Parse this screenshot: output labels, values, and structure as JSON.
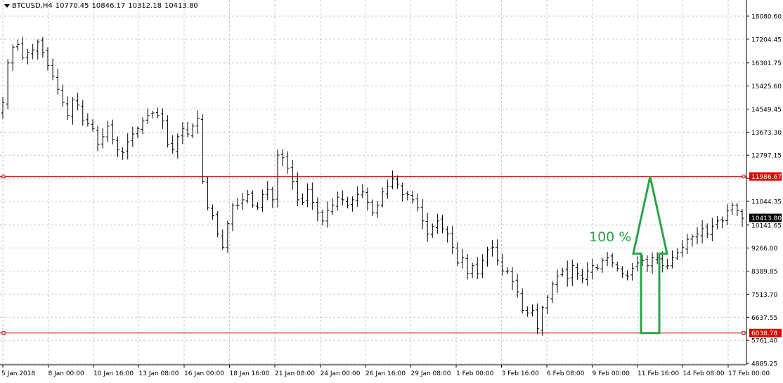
{
  "header": {
    "symbol": "BTCUSD,H4",
    "open": "10770.45",
    "high": "10846.17",
    "low": "10312.18",
    "close": "10413.80"
  },
  "colors": {
    "background": "#ffffff",
    "grid": "#c8c8c8",
    "candle": "#000000",
    "level_line": "#cc0000",
    "level_label_bg": "#e00000",
    "price_label_bg": "#000000",
    "arrow": "#2aa34a"
  },
  "annotation": {
    "text": "100 %",
    "from": 6038.78,
    "to": 11986.67,
    "at": "11 Feb 16:00"
  },
  "chart_data": {
    "type": "candlestick",
    "title": "BTCUSD,H4",
    "ylim": [
      4885.25,
      18500
    ],
    "y_ticks": [
      "18080.60",
      "17204.45",
      "16301.75",
      "15425.60",
      "14549.45",
      "13673.30",
      "12797.15",
      "11920.50",
      "11044.35",
      "10141.65",
      "9266.00",
      "8389.85",
      "7513.70",
      "6637.55",
      "5761.40",
      "4885.25"
    ],
    "x_ticks": [
      "5 Jan 2018",
      "8 Jan 00:00",
      "10 Jan 16:00",
      "13 Jan 08:00",
      "16 Jan 00:00",
      "18 Jan 16:00",
      "21 Jan 08:00",
      "24 Jan 00:00",
      "26 Jan 16:00",
      "29 Jan 08:00",
      "1 Feb 00:00",
      "3 Feb 16:00",
      "6 Feb 08:00",
      "9 Feb 00:00",
      "11 Feb 16:00",
      "14 Feb 08:00",
      "17 Feb 00:00"
    ],
    "horizontal_levels": [
      {
        "value": 11986.67,
        "label": "11986.67"
      },
      {
        "value": 6038.78,
        "label": "6038.78"
      }
    ],
    "current_price": {
      "value": 10413.8,
      "label": "10413.80"
    },
    "series_close": [
      14800,
      16300,
      16900,
      17000,
      16500,
      16700,
      16800,
      17100,
      16700,
      16200,
      15800,
      15300,
      14800,
      14300,
      14900,
      14700,
      14100,
      14000,
      13800,
      13200,
      13500,
      13900,
      13400,
      13000,
      12900,
      13300,
      13600,
      13800,
      14100,
      14300,
      14400,
      14300,
      14100,
      13200,
      13000,
      13500,
      13800,
      13600,
      13900,
      14200,
      11800,
      10800,
      10500,
      9800,
      9300,
      10200,
      10900,
      10900,
      11100,
      11300,
      10900,
      10800,
      11300,
      11500,
      11100,
      12800,
      12700,
      12300,
      11800,
      11100,
      11000,
      11500,
      11000,
      10600,
      10300,
      10700,
      10900,
      11200,
      11100,
      10900,
      11100,
      11300,
      11400,
      11000,
      10600,
      10900,
      11400,
      11600,
      11900,
      11700,
      11300,
      11300,
      11100,
      10800,
      10300,
      9800,
      10100,
      10300,
      10000,
      9800,
      9300,
      8700,
      8900,
      8300,
      8600,
      8300,
      8800,
      9200,
      9300,
      8800,
      8400,
      8400,
      8000,
      7600,
      6900,
      6800,
      6900,
      6200,
      7000,
      7400,
      7900,
      8200,
      8400,
      8100,
      8600,
      8300,
      8100,
      8400,
      8600,
      8500,
      8800,
      8900,
      8700,
      8500,
      8300,
      8200,
      8500,
      8700,
      8800,
      8600,
      8900,
      8900,
      8600,
      8600,
      8900,
      9100,
      9300,
      9600,
      9700,
      9800,
      10000,
      9800,
      10100,
      10300,
      10300,
      10700,
      10900,
      10700,
      10400
    ]
  }
}
